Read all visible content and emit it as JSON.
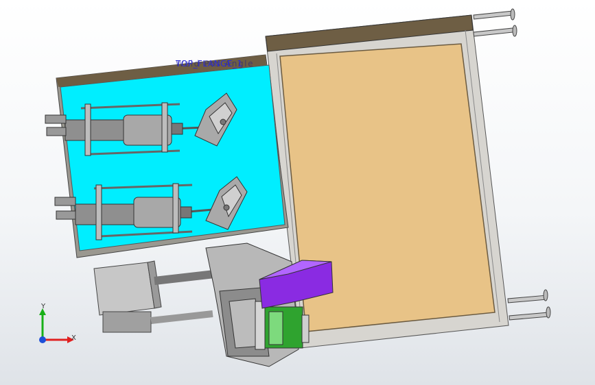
{
  "viewport": {
    "annotation_label": "TOP_FLANGE_1",
    "annotation_overlay": "Weld Pos Angle",
    "triad": {
      "x_label": "X",
      "y_label": "Y"
    }
  },
  "colors": {
    "plate_cyan": "#00eeff",
    "panel_tan": "#e8c387",
    "frame_gray": "#d7d5d0",
    "rail_brown": "#6e5e44",
    "clamp_purple": "#8a2be2",
    "band_green": "#2fa32f",
    "axis_red": "#e02020",
    "axis_green": "#18b018",
    "axis_blue": "#1e4fd8"
  },
  "icons": [
    "coordinate-triad-icon"
  ]
}
